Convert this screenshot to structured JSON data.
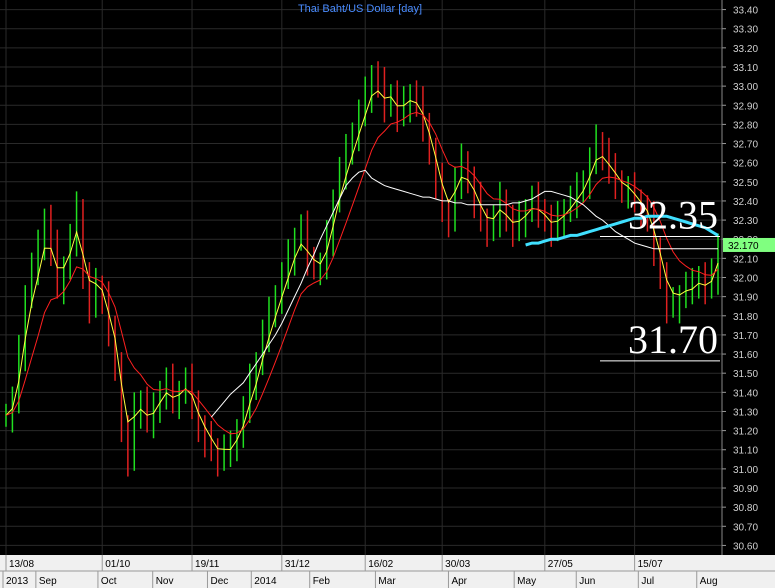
{
  "chart_data": {
    "type": "line",
    "title": "Thai Baht/US Dollar [day]",
    "ylim": [
      30.55,
      33.45
    ],
    "y_ticks": [
      "33.40",
      "33.30",
      "33.20",
      "33.10",
      "33.00",
      "32.90",
      "32.80",
      "32.70",
      "32.60",
      "32.50",
      "32.40",
      "32.30",
      "32.20",
      "32.10",
      "32.00",
      "31.90",
      "31.80",
      "31.70",
      "31.60",
      "31.50",
      "31.40",
      "31.30",
      "31.20",
      "31.10",
      "31.00",
      "30.90",
      "30.80",
      "30.70",
      "30.60"
    ],
    "date_ticks": [
      "13/08",
      "01/10",
      "19/11",
      "31/12",
      "16/02",
      "30/03",
      "27/05",
      "15/07"
    ],
    "month_ticks": [
      "2013",
      "Sep",
      "Oct",
      "Nov",
      "Dec",
      "2014",
      "Feb",
      "Mar",
      "Apr",
      "May",
      "Jun",
      "Jul",
      "Aug"
    ],
    "last_price": "32.170",
    "annotations": [
      "32.35",
      "31.70"
    ],
    "annotation_levels": [
      32.35,
      31.7
    ],
    "grid": true,
    "series_close": [
      31.28,
      31.35,
      31.6,
      31.9,
      32.05,
      32.15,
      32.3,
      32.15,
      31.95,
      32.05,
      32.2,
      32.35,
      32.0,
      31.85,
      31.95,
      31.9,
      31.7,
      31.55,
      31.2,
      31.05,
      31.3,
      31.35,
      31.25,
      31.3,
      31.4,
      31.45,
      31.35,
      31.4,
      31.45,
      31.35,
      31.2,
      31.15,
      31.1,
      31.05,
      31.1,
      31.1,
      31.2,
      31.3,
      31.45,
      31.55,
      31.7,
      31.8,
      31.9,
      32.0,
      32.1,
      32.2,
      32.25,
      32.1,
      32.05,
      32.05,
      32.2,
      32.4,
      32.55,
      32.65,
      32.75,
      32.85,
      32.95,
      33.05,
      33.0,
      32.9,
      32.95,
      32.85,
      32.9,
      32.95,
      32.9,
      32.8,
      32.65,
      32.5,
      32.35,
      32.3,
      32.5,
      32.6,
      32.5,
      32.4,
      32.3,
      32.25,
      32.3,
      32.4,
      32.3,
      32.25,
      32.3,
      32.35,
      32.4,
      32.35,
      32.3,
      32.25,
      32.3,
      32.35,
      32.4,
      32.45,
      32.5,
      32.6,
      32.7,
      32.65,
      32.55,
      32.5,
      32.45,
      32.45,
      32.4,
      32.35,
      32.3,
      32.15,
      32.0,
      31.85,
      31.85,
      31.9,
      31.95,
      31.95,
      32.0,
      31.95,
      32.0,
      32.17
    ],
    "series_ma_long": [
      null,
      null,
      null,
      null,
      null,
      null,
      null,
      null,
      null,
      null,
      null,
      null,
      null,
      null,
      null,
      null,
      null,
      null,
      null,
      null,
      null,
      null,
      null,
      null,
      null,
      null,
      null,
      null,
      null,
      null,
      null,
      null,
      31.27,
      31.31,
      31.35,
      31.39,
      31.42,
      31.45,
      31.5,
      31.55,
      31.6,
      31.65,
      31.7,
      31.76,
      31.83,
      31.9,
      31.97,
      32.05,
      32.12,
      32.2,
      32.27,
      32.34,
      32.41,
      32.48,
      32.52,
      32.55,
      32.56,
      32.52,
      32.5,
      32.48,
      32.47,
      32.46,
      32.45,
      32.44,
      32.43,
      32.42,
      32.42,
      32.41,
      32.4,
      32.4,
      32.39,
      32.39,
      32.38,
      32.38,
      32.38,
      32.38,
      32.38,
      32.38,
      32.38,
      32.39,
      32.39,
      32.4,
      32.41,
      32.43,
      32.45,
      32.45,
      32.44,
      32.43,
      32.42,
      32.4,
      32.38,
      32.35,
      32.32,
      32.3,
      32.27,
      32.24,
      32.22,
      32.2,
      32.18,
      32.17,
      32.16,
      32.15,
      32.15,
      32.15,
      32.15,
      32.15,
      32.15,
      32.15,
      32.15,
      32.15,
      32.15,
      32.15
    ],
    "series_ma_cyan": [
      32.17,
      32.18,
      32.18,
      32.19,
      32.2,
      32.2,
      32.21,
      32.22,
      32.22,
      32.23,
      32.24,
      32.25,
      32.26,
      32.27,
      32.28,
      32.29,
      32.3,
      32.31,
      32.31,
      32.32,
      32.32,
      32.32,
      32.32,
      32.31,
      32.3,
      32.29,
      32.28,
      32.27,
      32.26,
      32.24,
      32.22
    ]
  },
  "colors": {
    "background": "#000000",
    "grid": "#2a2a2a",
    "axis_panel": "#f0f0f0",
    "title": "#4a8cff",
    "up_bar": "#20e020",
    "down_bar": "#e02020",
    "ma_yellow": "#ffff40",
    "ma_red": "#ff2020",
    "ma_white": "#ffffff",
    "ma_cyan": "#40e0ff",
    "last_price_bg": "#80ff80"
  }
}
